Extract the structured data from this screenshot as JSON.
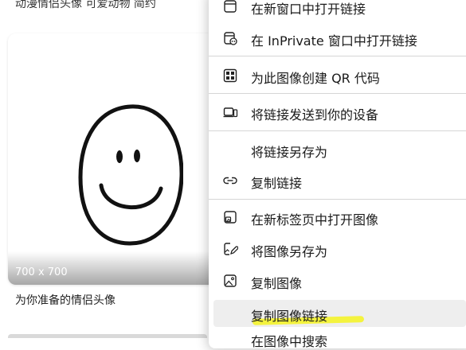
{
  "background_page": {
    "top_text": "动漫情侣头像 可爱动物 简约",
    "image_card": {
      "dimensions": "700 x 700"
    },
    "caption": "为你准备的情侣头像"
  },
  "context_menu": {
    "items": [
      {
        "label": "在新窗口中打开链接",
        "icon": "new-window-icon"
      },
      {
        "label": "在 InPrivate 窗口中打开链接",
        "icon": "inprivate-window-icon"
      },
      {
        "label": "为此图像创建 QR 代码",
        "icon": "qr-code-icon"
      },
      {
        "label": "将链接发送到你的设备",
        "icon": "send-to-devices-icon"
      },
      {
        "label": "将链接另存为",
        "icon": ""
      },
      {
        "label": "复制链接",
        "icon": "link-icon"
      },
      {
        "label": "在新标签页中打开图像",
        "icon": "open-image-new-tab-icon"
      },
      {
        "label": "将图像另存为",
        "icon": "save-image-icon"
      },
      {
        "label": "复制图像",
        "icon": "image-icon"
      },
      {
        "label": "复制图像链接",
        "icon": ""
      }
    ],
    "partially_visible_item": "在图像中搜索"
  },
  "colors": {
    "highlight_marker": "#f4f32a",
    "menu_hover": "#eeeeee",
    "separator": "#d6d6d6"
  }
}
